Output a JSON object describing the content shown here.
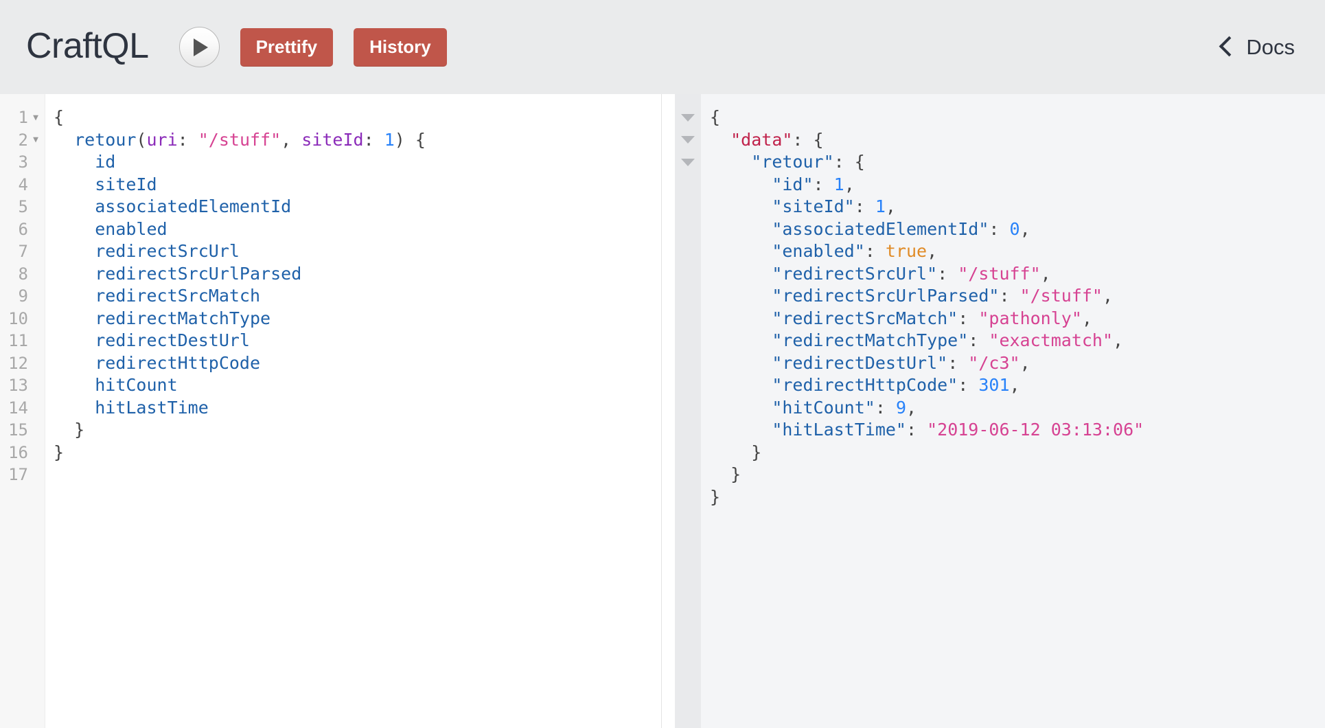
{
  "header": {
    "logo": "CraftQL",
    "execute_button": "execute-query",
    "prettify_label": "Prettify",
    "history_label": "History",
    "docs_label": "Docs"
  },
  "query_editor": {
    "line_numbers": [
      "1",
      "2",
      "3",
      "4",
      "5",
      "6",
      "7",
      "8",
      "9",
      "10",
      "11",
      "12",
      "13",
      "14",
      "15",
      "16",
      "17"
    ],
    "foldable_lines": [
      1,
      2
    ],
    "lines": [
      {
        "n": "1",
        "tokens": [
          {
            "t": "{",
            "c": "q-punc"
          }
        ]
      },
      {
        "n": "2",
        "tokens": [
          {
            "t": "  ",
            "c": "q-punc"
          },
          {
            "t": "retour",
            "c": "q-field"
          },
          {
            "t": "(",
            "c": "q-punc"
          },
          {
            "t": "uri",
            "c": "q-arg"
          },
          {
            "t": ": ",
            "c": "q-punc"
          },
          {
            "t": "\"/stuff\"",
            "c": "q-str"
          },
          {
            "t": ", ",
            "c": "q-punc"
          },
          {
            "t": "siteId",
            "c": "q-arg"
          },
          {
            "t": ": ",
            "c": "q-punc"
          },
          {
            "t": "1",
            "c": "q-num"
          },
          {
            "t": ") {",
            "c": "q-punc"
          }
        ]
      },
      {
        "n": "3",
        "tokens": [
          {
            "t": "    ",
            "c": "q-punc"
          },
          {
            "t": "id",
            "c": "q-field"
          }
        ]
      },
      {
        "n": "4",
        "tokens": [
          {
            "t": "    ",
            "c": "q-punc"
          },
          {
            "t": "siteId",
            "c": "q-field"
          }
        ]
      },
      {
        "n": "5",
        "tokens": [
          {
            "t": "    ",
            "c": "q-punc"
          },
          {
            "t": "associatedElementId",
            "c": "q-field"
          }
        ]
      },
      {
        "n": "6",
        "tokens": [
          {
            "t": "    ",
            "c": "q-punc"
          },
          {
            "t": "enabled",
            "c": "q-field"
          }
        ]
      },
      {
        "n": "7",
        "tokens": [
          {
            "t": "    ",
            "c": "q-punc"
          },
          {
            "t": "redirectSrcUrl",
            "c": "q-field"
          }
        ]
      },
      {
        "n": "8",
        "tokens": [
          {
            "t": "    ",
            "c": "q-punc"
          },
          {
            "t": "redirectSrcUrlParsed",
            "c": "q-field"
          }
        ]
      },
      {
        "n": "9",
        "tokens": [
          {
            "t": "    ",
            "c": "q-punc"
          },
          {
            "t": "redirectSrcMatch",
            "c": "q-field"
          }
        ]
      },
      {
        "n": "10",
        "tokens": [
          {
            "t": "    ",
            "c": "q-punc"
          },
          {
            "t": "redirectMatchType",
            "c": "q-field"
          }
        ]
      },
      {
        "n": "11",
        "tokens": [
          {
            "t": "    ",
            "c": "q-punc"
          },
          {
            "t": "redirectDestUrl",
            "c": "q-field"
          }
        ]
      },
      {
        "n": "12",
        "tokens": [
          {
            "t": "    ",
            "c": "q-punc"
          },
          {
            "t": "redirectHttpCode",
            "c": "q-field"
          }
        ]
      },
      {
        "n": "13",
        "tokens": [
          {
            "t": "    ",
            "c": "q-punc"
          },
          {
            "t": "hitCount",
            "c": "q-field"
          }
        ]
      },
      {
        "n": "14",
        "tokens": [
          {
            "t": "    ",
            "c": "q-punc"
          },
          {
            "t": "hitLastTime",
            "c": "q-field"
          }
        ]
      },
      {
        "n": "15",
        "tokens": [
          {
            "t": "  }",
            "c": "q-punc"
          }
        ]
      },
      {
        "n": "16",
        "tokens": [
          {
            "t": "}",
            "c": "q-punc"
          }
        ]
      },
      {
        "n": "17",
        "tokens": [
          {
            "t": "",
            "c": "q-punc"
          }
        ]
      }
    ]
  },
  "result_viewer": {
    "fold_rows": [
      true,
      true,
      true,
      false,
      false,
      false,
      false,
      false,
      false,
      false,
      false,
      false,
      false,
      false,
      false,
      false,
      false,
      false,
      false
    ],
    "lines": [
      {
        "tokens": [
          {
            "t": "{",
            "c": "j-punc"
          }
        ]
      },
      {
        "tokens": [
          {
            "t": "  ",
            "c": "j-punc"
          },
          {
            "t": "\"data\"",
            "c": "j-key-top"
          },
          {
            "t": ": {",
            "c": "j-punc"
          }
        ]
      },
      {
        "tokens": [
          {
            "t": "    ",
            "c": "j-punc"
          },
          {
            "t": "\"retour\"",
            "c": "j-key"
          },
          {
            "t": ": {",
            "c": "j-punc"
          }
        ]
      },
      {
        "tokens": [
          {
            "t": "      ",
            "c": "j-punc"
          },
          {
            "t": "\"id\"",
            "c": "j-key"
          },
          {
            "t": ": ",
            "c": "j-punc"
          },
          {
            "t": "1",
            "c": "j-num"
          },
          {
            "t": ",",
            "c": "j-punc"
          }
        ]
      },
      {
        "tokens": [
          {
            "t": "      ",
            "c": "j-punc"
          },
          {
            "t": "\"siteId\"",
            "c": "j-key"
          },
          {
            "t": ": ",
            "c": "j-punc"
          },
          {
            "t": "1",
            "c": "j-num"
          },
          {
            "t": ",",
            "c": "j-punc"
          }
        ]
      },
      {
        "tokens": [
          {
            "t": "      ",
            "c": "j-punc"
          },
          {
            "t": "\"associatedElementId\"",
            "c": "j-key"
          },
          {
            "t": ": ",
            "c": "j-punc"
          },
          {
            "t": "0",
            "c": "j-num"
          },
          {
            "t": ",",
            "c": "j-punc"
          }
        ]
      },
      {
        "tokens": [
          {
            "t": "      ",
            "c": "j-punc"
          },
          {
            "t": "\"enabled\"",
            "c": "j-key"
          },
          {
            "t": ": ",
            "c": "j-punc"
          },
          {
            "t": "true",
            "c": "j-bool"
          },
          {
            "t": ",",
            "c": "j-punc"
          }
        ]
      },
      {
        "tokens": [
          {
            "t": "      ",
            "c": "j-punc"
          },
          {
            "t": "\"redirectSrcUrl\"",
            "c": "j-key"
          },
          {
            "t": ": ",
            "c": "j-punc"
          },
          {
            "t": "\"/stuff\"",
            "c": "j-str"
          },
          {
            "t": ",",
            "c": "j-punc"
          }
        ]
      },
      {
        "tokens": [
          {
            "t": "      ",
            "c": "j-punc"
          },
          {
            "t": "\"redirectSrcUrlParsed\"",
            "c": "j-key"
          },
          {
            "t": ": ",
            "c": "j-punc"
          },
          {
            "t": "\"/stuff\"",
            "c": "j-str"
          },
          {
            "t": ",",
            "c": "j-punc"
          }
        ]
      },
      {
        "tokens": [
          {
            "t": "      ",
            "c": "j-punc"
          },
          {
            "t": "\"redirectSrcMatch\"",
            "c": "j-key"
          },
          {
            "t": ": ",
            "c": "j-punc"
          },
          {
            "t": "\"pathonly\"",
            "c": "j-str"
          },
          {
            "t": ",",
            "c": "j-punc"
          }
        ]
      },
      {
        "tokens": [
          {
            "t": "      ",
            "c": "j-punc"
          },
          {
            "t": "\"redirectMatchType\"",
            "c": "j-key"
          },
          {
            "t": ": ",
            "c": "j-punc"
          },
          {
            "t": "\"exactmatch\"",
            "c": "j-str"
          },
          {
            "t": ",",
            "c": "j-punc"
          }
        ]
      },
      {
        "tokens": [
          {
            "t": "      ",
            "c": "j-punc"
          },
          {
            "t": "\"redirectDestUrl\"",
            "c": "j-key"
          },
          {
            "t": ": ",
            "c": "j-punc"
          },
          {
            "t": "\"/c3\"",
            "c": "j-str"
          },
          {
            "t": ",",
            "c": "j-punc"
          }
        ]
      },
      {
        "tokens": [
          {
            "t": "      ",
            "c": "j-punc"
          },
          {
            "t": "\"redirectHttpCode\"",
            "c": "j-key"
          },
          {
            "t": ": ",
            "c": "j-punc"
          },
          {
            "t": "301",
            "c": "j-num"
          },
          {
            "t": ",",
            "c": "j-punc"
          }
        ]
      },
      {
        "tokens": [
          {
            "t": "      ",
            "c": "j-punc"
          },
          {
            "t": "\"hitCount\"",
            "c": "j-key"
          },
          {
            "t": ": ",
            "c": "j-punc"
          },
          {
            "t": "9",
            "c": "j-num"
          },
          {
            "t": ",",
            "c": "j-punc"
          }
        ]
      },
      {
        "tokens": [
          {
            "t": "      ",
            "c": "j-punc"
          },
          {
            "t": "\"hitLastTime\"",
            "c": "j-key"
          },
          {
            "t": ": ",
            "c": "j-punc"
          },
          {
            "t": "\"2019-06-12 03:13:06\"",
            "c": "j-str"
          }
        ]
      },
      {
        "tokens": [
          {
            "t": "    }",
            "c": "j-punc"
          }
        ]
      },
      {
        "tokens": [
          {
            "t": "  }",
            "c": "j-punc"
          }
        ]
      },
      {
        "tokens": [
          {
            "t": "}",
            "c": "j-punc"
          }
        ]
      }
    ]
  },
  "colors": {
    "header_bg": "#eaebec",
    "button_bg": "#c0564a",
    "result_bg": "#f4f5f7",
    "editor_bg": "#ffffff",
    "gutter_bg": "#f7f7f7",
    "result_gutter_bg": "#e9eaec",
    "field_blue": "#1f61a9",
    "arg_purple": "#8b2bb9",
    "string_pink": "#d64292",
    "number_blue": "#2882f9",
    "bool_orange": "#e08b27",
    "data_key_red": "#c0224b",
    "logo_color": "#2e3440"
  }
}
